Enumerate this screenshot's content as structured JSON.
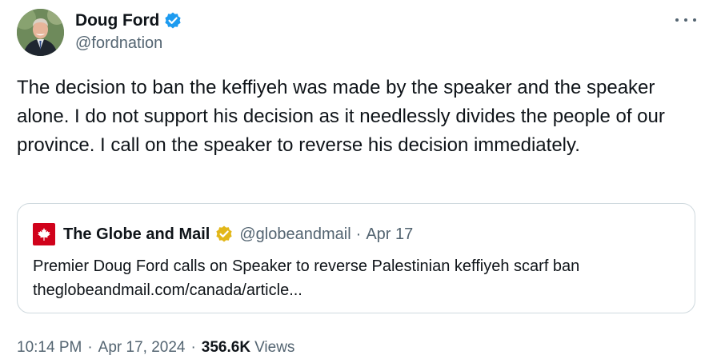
{
  "author": {
    "name": "Doug Ford",
    "handle": "@fordnation",
    "verified_color": "#1d9bf0"
  },
  "more_icon": "more-horizontal-icon",
  "tweet": {
    "text": "The decision to ban the keffiyeh was made by the speaker and the speaker alone. I do not support his decision as it needlessly divides the people of our province. I call on the speaker to reverse his decision immediately."
  },
  "quoted": {
    "name": "The Globe and Mail",
    "handle": "@globeandmail",
    "separator": "·",
    "date": "Apr 17",
    "badge_color": "#e2b719",
    "logo_color": "#d0021b",
    "text_line1": "Premier Doug Ford calls on Speaker to reverse Palestinian keffiyeh scarf ban",
    "text_line2": "theglobeandmail.com/canada/article..."
  },
  "meta": {
    "time": "10:14 PM",
    "separator": "·",
    "date": "Apr 17, 2024",
    "views_count": "356.6K",
    "views_label": "Views"
  }
}
